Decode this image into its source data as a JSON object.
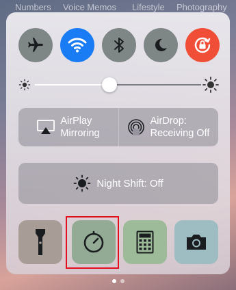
{
  "background_apps": [
    "Numbers",
    "Voice Memos",
    "Lifestyle",
    "Photography"
  ],
  "toggles": [
    {
      "name": "airplane-mode",
      "state": "off"
    },
    {
      "name": "wifi",
      "state": "on"
    },
    {
      "name": "bluetooth",
      "state": "off"
    },
    {
      "name": "do-not-disturb",
      "state": "off"
    },
    {
      "name": "rotation-lock",
      "state": "on"
    }
  ],
  "brightness": {
    "level": 0.45
  },
  "airplay": {
    "line1": "AirPlay",
    "line2": "Mirroring"
  },
  "airdrop": {
    "line1": "AirDrop:",
    "line2": "Receiving Off"
  },
  "night_shift": {
    "label": "Night Shift: Off"
  },
  "tools": [
    "flashlight",
    "timer",
    "calculator",
    "camera"
  ],
  "highlighted_tool": "timer",
  "page_indicator": {
    "count": 2,
    "current": 1
  },
  "colors": {
    "wifi_on": "#1a7cf5",
    "rotation_lock_on": "#f04e37",
    "toggle_off": "#7f8686",
    "highlight_box": "#e30f1c"
  }
}
